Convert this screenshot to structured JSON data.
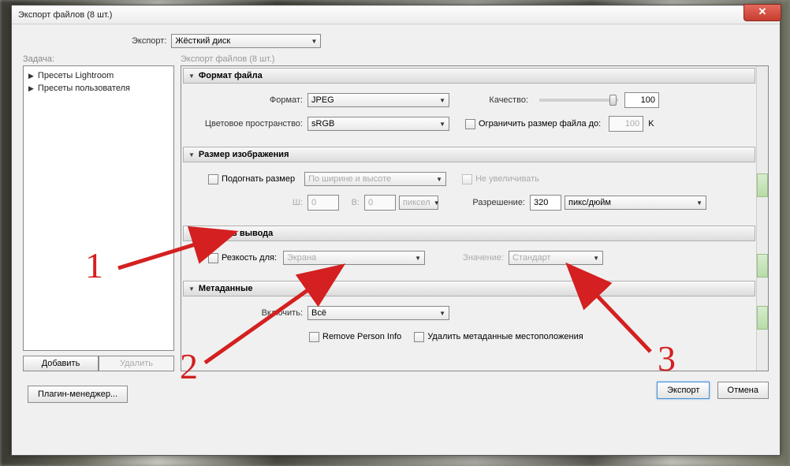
{
  "window": {
    "title": "Экспорт файлов (8 шт.)"
  },
  "export": {
    "label": "Экспорт:",
    "value": "Жёсткий диск"
  },
  "task_label": "Задача:",
  "presets": [
    "Пресеты Lightroom",
    "Пресеты пользователя"
  ],
  "buttons": {
    "add": "Добавить",
    "remove": "Удалить",
    "plugin_manager": "Плагин-менеджер...",
    "export": "Экспорт",
    "cancel": "Отмена"
  },
  "right_label": "Экспорт файлов (8 шт.)",
  "sections": {
    "file_format": {
      "title": "Формат файла",
      "format_label": "Формат:",
      "format_value": "JPEG",
      "quality_label": "Качество:",
      "quality_value": "100",
      "colorspace_label": "Цветовое пространство:",
      "colorspace_value": "sRGB",
      "limit_label": "Ограничить размер файла до:",
      "limit_value": "100",
      "limit_unit": "K"
    },
    "image_size": {
      "title": "Размер изображения",
      "fit_label": "Подогнать размер",
      "fit_value": "По ширине и высоте",
      "no_enlarge_label": "Не увеличивать",
      "w_label": "Ш:",
      "w_value": "0",
      "h_label": "В:",
      "h_value": "0",
      "wh_unit": "пиксел",
      "res_label": "Разрешение:",
      "res_value": "320",
      "res_unit": "пикс/дюйм"
    },
    "sharpening": {
      "title": "Резкость вывода",
      "for_label": "Резкость для:",
      "for_value": "Экрана",
      "amount_label": "Значение:",
      "amount_value": "Стандарт"
    },
    "metadata": {
      "title": "Метаданные",
      "include_label": "Включить:",
      "include_value": "Всё",
      "remove_person": "Remove Person Info",
      "remove_location": "Удалить метаданные местоположения"
    }
  },
  "annotations": {
    "n1": "1",
    "n2": "2",
    "n3": "3"
  }
}
